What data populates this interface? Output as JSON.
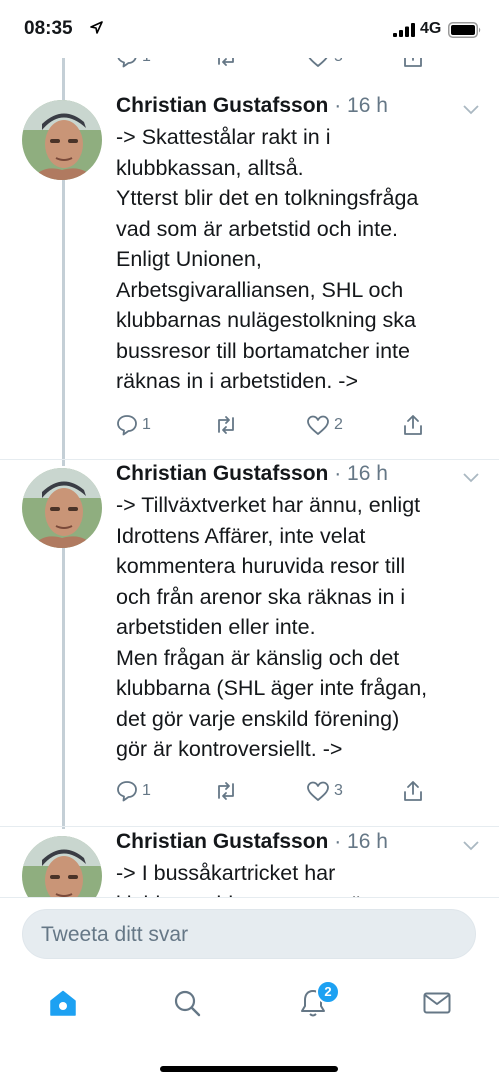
{
  "status_bar": {
    "time": "08:35",
    "network": "4G"
  },
  "top_actions": {
    "reply_count": "1",
    "retweet_count": "",
    "like_count": "5"
  },
  "tweets": [
    {
      "author": "Christian Gustafsson",
      "separator": " · ",
      "time": "16 h",
      "text": "-> Skattestålar rakt in i\nklubbkassan, alltså.\nYtterst blir det en tolkningsfråga\nvad som är arbetstid och inte.\nEnligt Unionen,\nArbetsgivaralliansen, SHL och\nklubbarnas nulägestolkning ska\nbussresor till bortamatcher inte\nräknas in i arbetstiden. ->",
      "reply_count": "1",
      "like_count": "2"
    },
    {
      "author": "Christian Gustafsson",
      "separator": " · ",
      "time": "16 h",
      "text": "-> Tillväxtverket har ännu, enligt\nIdrottens Affärer, inte velat\nkommentera huruvida resor till\noch från arenor ska räknas in i\narbetstiden eller inte.\nMen frågan är känslig och det\nklubbarna (SHL äger inte frågan,\ndet gör varje enskild förening)\ngör är kontroversiellt. ->",
      "reply_count": "1",
      "like_count": "3"
    },
    {
      "author": "Christian Gustafsson",
      "separator": " · ",
      "time": "16 h",
      "text": "-> I bussåkartricket har\nklubbarna hittat ett nytt sätt att"
    }
  ],
  "compose": {
    "placeholder": "Tweeta ditt svar"
  },
  "tabbar": {
    "items": [
      {
        "icon": "home-icon",
        "active": true
      },
      {
        "icon": "search-icon",
        "active": false
      },
      {
        "icon": "notifications-icon",
        "active": false,
        "badge": "2"
      },
      {
        "icon": "messages-icon",
        "active": false
      }
    ]
  },
  "colors": {
    "accent": "#1da1f2",
    "text": "#14171a",
    "secondary": "#657786",
    "divider": "#e6ecf0"
  }
}
